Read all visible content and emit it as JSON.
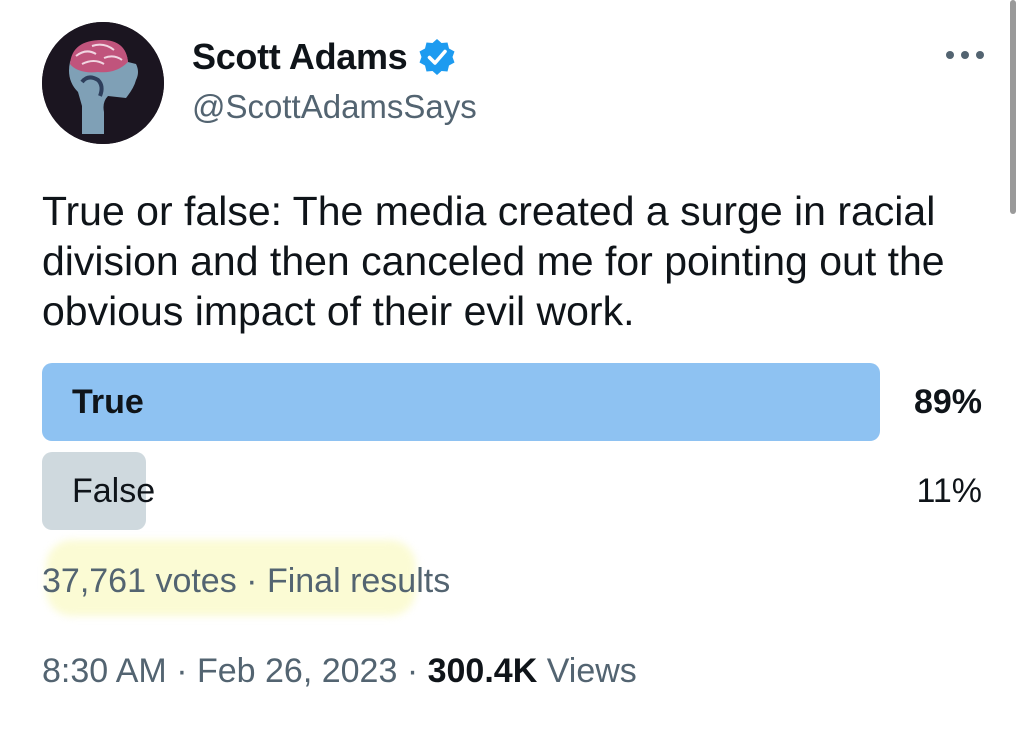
{
  "author": {
    "name": "Scott Adams",
    "handle": "@ScottAdamsSays",
    "verified": true,
    "avatar_icon": "brain-head-avatar"
  },
  "menu_icon": "more-icon",
  "tweet": {
    "text": "True or false: The media created a surge in racial division and then canceled me for pointing out the obvious impact of their evil work."
  },
  "poll": {
    "options": [
      {
        "label": "True",
        "percent_label": "89%",
        "percent": 89,
        "winner": true
      },
      {
        "label": "False",
        "percent_label": "11%",
        "percent": 11,
        "winner": false
      }
    ],
    "votes": "37,761 votes",
    "separator": "·",
    "status": "Final results"
  },
  "meta": {
    "time": "8:30 AM",
    "date": "Feb 26, 2023",
    "views_count": "300.4K",
    "views_label": "Views",
    "separator": "·"
  },
  "colors": {
    "winner_bar": "#8ec2f2",
    "other_bar": "#cfd9de",
    "verified_badge": "#1d9bf0",
    "secondary_text": "#536471",
    "highlight": "#fbfbd4"
  }
}
